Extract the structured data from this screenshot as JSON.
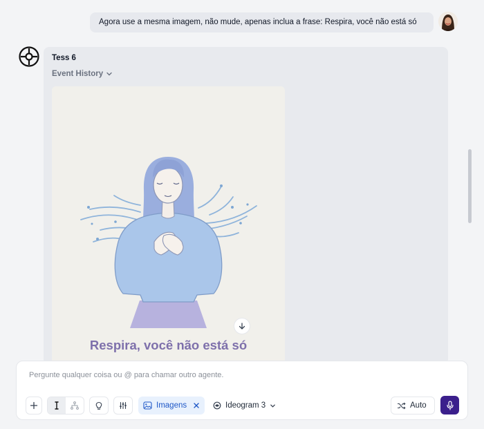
{
  "conversation": {
    "user_message": "Agora use a mesma imagem, não mude, apenas inclua a frase: Respira, você não está só",
    "agent": {
      "name": "Tess 6",
      "event_history_label": "Event History",
      "image_caption": "Respira, você não está só"
    }
  },
  "composer": {
    "placeholder": "Pergunte qualquer coisa ou @ para chamar outro agente.",
    "tools": {
      "images_label": "Imagens",
      "model_label": "Ideogram 3",
      "auto_label": "Auto"
    }
  },
  "icons": [
    "tess-logo-icon",
    "chevron-down-icon",
    "arrow-down-icon",
    "plus-icon",
    "cursor-icon",
    "hierarchy-icon",
    "lightbulb-icon",
    "sliders-icon",
    "image-icon",
    "close-icon",
    "model-icon",
    "shuffle-icon",
    "microphone-icon"
  ],
  "colors": {
    "accent": "#3b1f8c",
    "images_pill_bg": "#e8f1fd",
    "images_pill_text": "#1f58c7",
    "caption": "#7e70ab"
  }
}
